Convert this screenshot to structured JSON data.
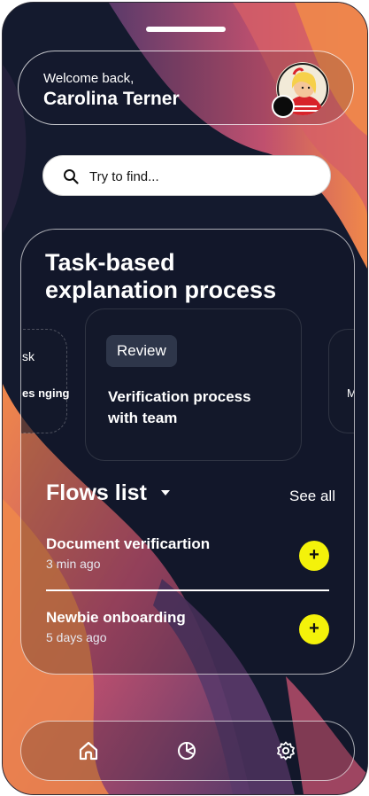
{
  "header": {
    "greeting": "Welcome back,",
    "user_name": "Carolina Terner"
  },
  "search": {
    "placeholder": "Try to find..."
  },
  "tasks_section": {
    "title": "Task-based explanation process",
    "cards": [
      {
        "partial_text_1": "sk",
        "partial_text_2": "es nging"
      },
      {
        "badge": "Review",
        "title": "Verification process with team"
      },
      {
        "partial_text": "M ith"
      }
    ]
  },
  "flows": {
    "title": "Flows list",
    "see_all": "See all",
    "items": [
      {
        "name": "Document verificartion",
        "time": "3 min ago",
        "action": "+"
      },
      {
        "name": "Newbie onboarding",
        "time": "5 days ago",
        "action": "+"
      }
    ]
  },
  "bottom_nav": {
    "items": [
      "home-icon",
      "pie-chart-icon",
      "settings-icon"
    ]
  },
  "colors": {
    "accent_yellow": "#f4f20a",
    "background_dark": "#141a2e",
    "wave_orange": "#f0884a",
    "wave_pink": "#c0506e",
    "wave_purple": "#5a3a6a"
  }
}
